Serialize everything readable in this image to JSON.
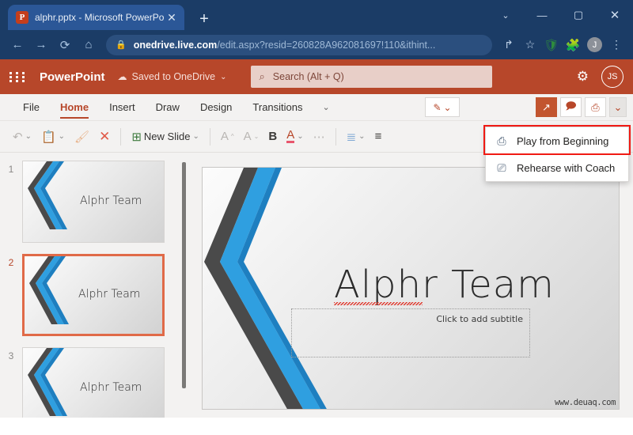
{
  "browser": {
    "tab": {
      "favicon_letter": "P",
      "title": "alphr.pptx - Microsoft PowerPoin",
      "close_glyph": "✕"
    },
    "new_tab_glyph": "+",
    "window_controls": {
      "chevron": "⌄",
      "minimize": "—",
      "maximize": "▢",
      "close": "✕"
    },
    "nav": {
      "back": "←",
      "forward": "→",
      "reload": "⟳",
      "home": "⌂"
    },
    "omnibox": {
      "lock": "🔒",
      "host": "onedrive.live.com",
      "path": "/edit.aspx?resid=260828A962081697!110&ithint..."
    },
    "toolbar_icons": {
      "share": "↱",
      "bookmark": "☆",
      "shield": "🛡",
      "extensions": "🧩",
      "profile_initial": "J",
      "menu": "⋮"
    }
  },
  "app": {
    "waffle_name": "app-launcher",
    "brand": "PowerPoint",
    "save_state": "Saved to OneDrive",
    "save_state_icon": "☁",
    "save_state_chevron": "⌄",
    "search": {
      "icon": "⌕",
      "placeholder": "Search (Alt + Q)",
      "value": ""
    },
    "settings_icon": "⚙",
    "account_initials": "JS",
    "accent_color": "#b7472a",
    "highlight_color": "#f01a14"
  },
  "ribbon": {
    "tabs": [
      {
        "label": "File",
        "active": false
      },
      {
        "label": "Home",
        "active": true
      },
      {
        "label": "Insert",
        "active": false
      },
      {
        "label": "Draw",
        "active": false
      },
      {
        "label": "Design",
        "active": false
      },
      {
        "label": "Transitions",
        "active": false
      }
    ],
    "more_tabs_chevron": "⌄",
    "right_buttons": {
      "pen_icon": "✎",
      "pen_chevron": "⌄",
      "share_icon": "↗",
      "comment_icon": "🗩",
      "present_icon": "⎙",
      "present_chevron": "⌄"
    },
    "toolbar": {
      "undo": "↶",
      "undo_chevron": "⌄",
      "paste": "📋",
      "paste_chevron": "⌄",
      "format_painter": "🖌",
      "cut": "✕",
      "new_slide_icon": "⊞",
      "new_slide_label": "New Slide",
      "new_slide_chevron": "⌄",
      "font_grow": "A",
      "font_shrink": "A",
      "bold": "B",
      "font_color": "A",
      "font_color_chevron": "⌄",
      "more_options": "⋯",
      "bullets": "☰",
      "bullets_chevron": "⌄",
      "align": "≡"
    }
  },
  "dropdown": {
    "items": [
      {
        "label": "Play from Beginning",
        "icon": "⎙",
        "highlighted": true
      },
      {
        "label": "Rehearse with Coach",
        "icon": "🎙",
        "highlighted": false
      }
    ]
  },
  "thumbnails": [
    {
      "number": "1",
      "title": "Alphr Team",
      "selected": false
    },
    {
      "number": "2",
      "title": "Alphr Team",
      "selected": true
    },
    {
      "number": "3",
      "title": "Alphr Team",
      "selected": false
    }
  ],
  "slide": {
    "title": "Alphr Team",
    "subtitle_placeholder": "Click to add subtitle",
    "watermark": "www.deuaq.com"
  }
}
